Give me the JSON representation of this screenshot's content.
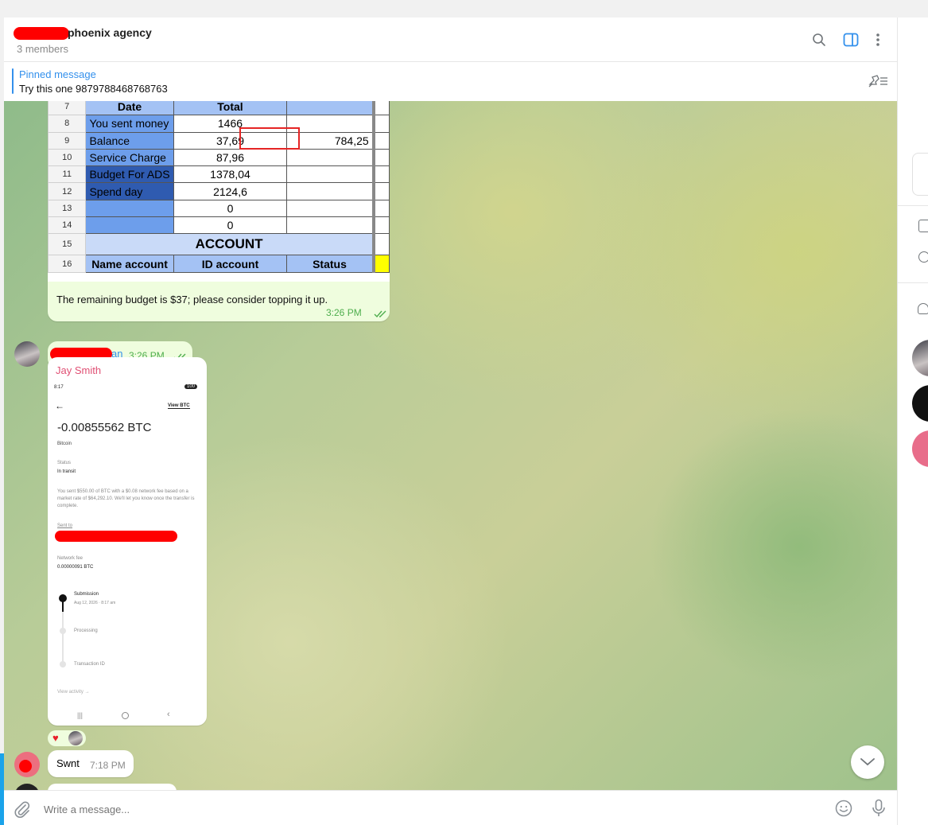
{
  "header": {
    "title": "phoenix agency",
    "members": "3 members"
  },
  "pinned": {
    "title": "Pinned message",
    "text": "Try this one 9879788468768763"
  },
  "sheet": {
    "rows": [
      {
        "n": "7",
        "a": "Date",
        "b": "Total",
        "c": ""
      },
      {
        "n": "8",
        "a": "You sent money",
        "b": "1466",
        "c": ""
      },
      {
        "n": "9",
        "a": "Balance",
        "b": "37,69",
        "c": "784,25"
      },
      {
        "n": "10",
        "a": "Service Charge",
        "b": "87,96",
        "c": ""
      },
      {
        "n": "11",
        "a": "Budget For  ADS",
        "b": "1378,04",
        "c": ""
      },
      {
        "n": "12",
        "a": "Spend day",
        "b": "2124,6",
        "c": ""
      },
      {
        "n": "13",
        "a": "",
        "b": "0",
        "c": ""
      },
      {
        "n": "14",
        "a": "",
        "b": "0",
        "c": ""
      }
    ],
    "row15": {
      "n": "15",
      "label": "ACCOUNT"
    },
    "row16": {
      "n": "16",
      "a": "Name account",
      "b": "ID account",
      "c": "Status"
    }
  },
  "messages": {
    "budget_caption": "The remaining budget is $37; please consider topping it up.",
    "budget_time": "3:26 PM",
    "redacted_suffix": "an",
    "redacted_time": "3:26 PM",
    "sender": "Jay Smith",
    "swnt_text": "Swnt",
    "swnt_time": "7:18 PM"
  },
  "phone": {
    "status_time": "8:17",
    "battery": "100",
    "view_btc": "View BTC",
    "amount": "-0.00855562 BTC",
    "asset": "Bitcoin",
    "status_label": "Status",
    "status_value": "In transit",
    "desc": "You sent $550.00 of BTC with a $0.08 network fee based on a market rate of $64,292.10. We'll let you know once the transfer is complete.",
    "sent_to": "Sent to",
    "fee_label": "Network fee",
    "fee_value": "0.00000091 BTC",
    "step1": "Submission",
    "step1_date": "Aug 12, 2026 · 8:17 am",
    "step2": "Processing",
    "step3": "Transaction ID",
    "view_activity": "View activity →"
  },
  "reaction": "♥",
  "composer": {
    "placeholder": "Write a message..."
  },
  "colors": {
    "accent": "#3390ec",
    "outgoing_bubble": "#effdde",
    "sender_name": "#e05074"
  }
}
